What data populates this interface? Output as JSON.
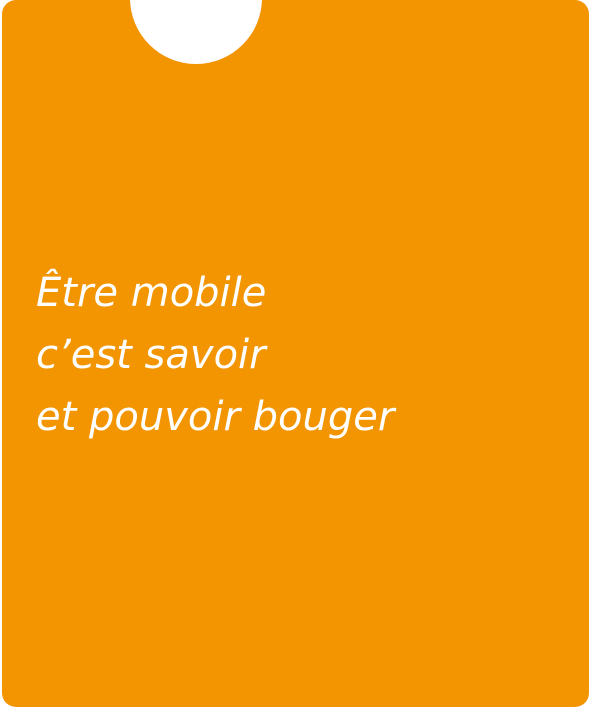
{
  "card": {
    "background_color": "#f29500",
    "notch_color": "#ffffff",
    "text_color": "#ffffff"
  },
  "headline": {
    "lines": [
      "Être mobile",
      "c’est savoir",
      "et pouvoir bouger"
    ]
  }
}
